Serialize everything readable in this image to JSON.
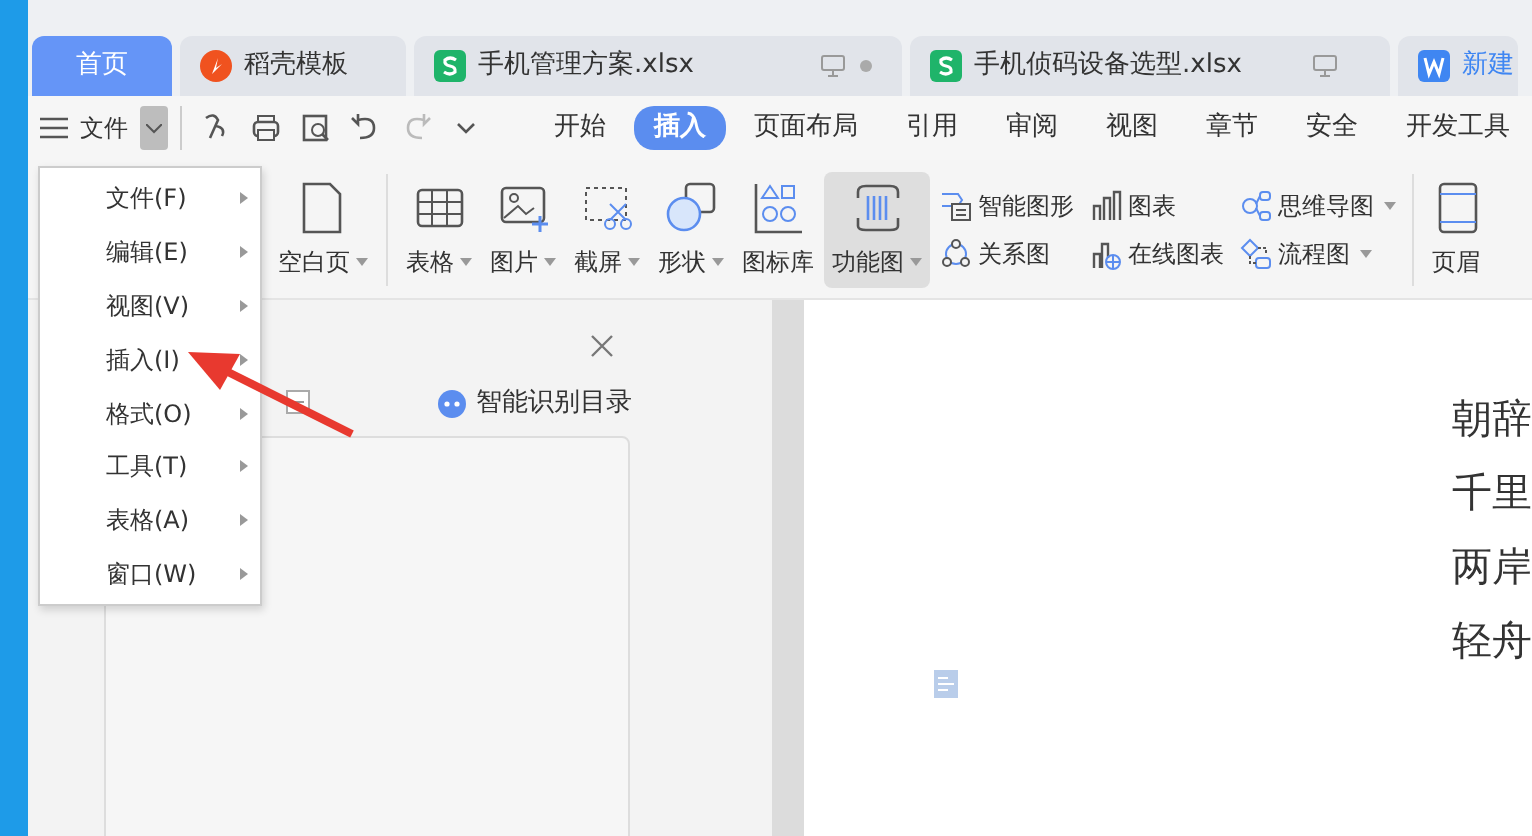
{
  "tabs": [
    {
      "label": "首页",
      "kind": "home",
      "selected": true,
      "monitor": false,
      "dot": false
    },
    {
      "label": "稻壳模板",
      "kind": "template",
      "selected": false,
      "monitor": false,
      "dot": false
    },
    {
      "label": "手机管理方案.xlsx",
      "kind": "sheet",
      "selected": false,
      "monitor": true,
      "dot": true
    },
    {
      "label": "手机侦码设备选型.xlsx",
      "kind": "sheet",
      "selected": false,
      "monitor": true,
      "dot": false
    },
    {
      "label": "新建",
      "kind": "doc",
      "selected": false
    }
  ],
  "file_menu_button": "文件",
  "ribbon_tabs": [
    {
      "label": "开始",
      "selected": false
    },
    {
      "label": "插入",
      "selected": true
    },
    {
      "label": "页面布局",
      "selected": false
    },
    {
      "label": "引用",
      "selected": false
    },
    {
      "label": "审阅",
      "selected": false
    },
    {
      "label": "视图",
      "selected": false
    },
    {
      "label": "章节",
      "selected": false
    },
    {
      "label": "安全",
      "selected": false
    },
    {
      "label": "开发工具",
      "selected": false
    }
  ],
  "ribbon_large": [
    {
      "label": "空白页",
      "kind": "page",
      "dropdown": true,
      "highlighted": false
    },
    {
      "label": "表格",
      "kind": "table",
      "dropdown": true,
      "highlighted": false
    },
    {
      "label": "图片",
      "kind": "image",
      "dropdown": true,
      "highlighted": false
    },
    {
      "label": "截屏",
      "kind": "screenshot",
      "dropdown": true,
      "highlighted": false
    },
    {
      "label": "形状",
      "kind": "shape",
      "dropdown": true,
      "highlighted": false
    },
    {
      "label": "图标库",
      "kind": "iconlib",
      "dropdown": false,
      "highlighted": false
    },
    {
      "label": "功能图",
      "kind": "barcode",
      "dropdown": true,
      "highlighted": true
    }
  ],
  "ribbon_small": [
    {
      "label": "智能图形",
      "kind": "smart",
      "dropdown": false
    },
    {
      "label": "关系图",
      "kind": "relation",
      "dropdown": false
    },
    {
      "label": "图表",
      "kind": "chart",
      "dropdown": false
    },
    {
      "label": "在线图表",
      "kind": "onlinechart",
      "dropdown": false
    },
    {
      "label": "思维导图",
      "kind": "mindmap",
      "dropdown": true
    },
    {
      "label": "流程图",
      "kind": "flow",
      "dropdown": true
    }
  ],
  "ribbon_last": "页眉",
  "side_panel": {
    "smart_toc": "智能识别目录"
  },
  "document_lines": [
    "朝辞",
    "千里",
    "两岸",
    "轻舟"
  ],
  "menu": [
    {
      "label": "文件(F)"
    },
    {
      "label": "编辑(E)"
    },
    {
      "label": "视图(V)"
    },
    {
      "label": "插入(I)"
    },
    {
      "label": "格式(O)"
    },
    {
      "label": "工具(T)"
    },
    {
      "label": "表格(A)"
    },
    {
      "label": "窗口(W)"
    }
  ]
}
